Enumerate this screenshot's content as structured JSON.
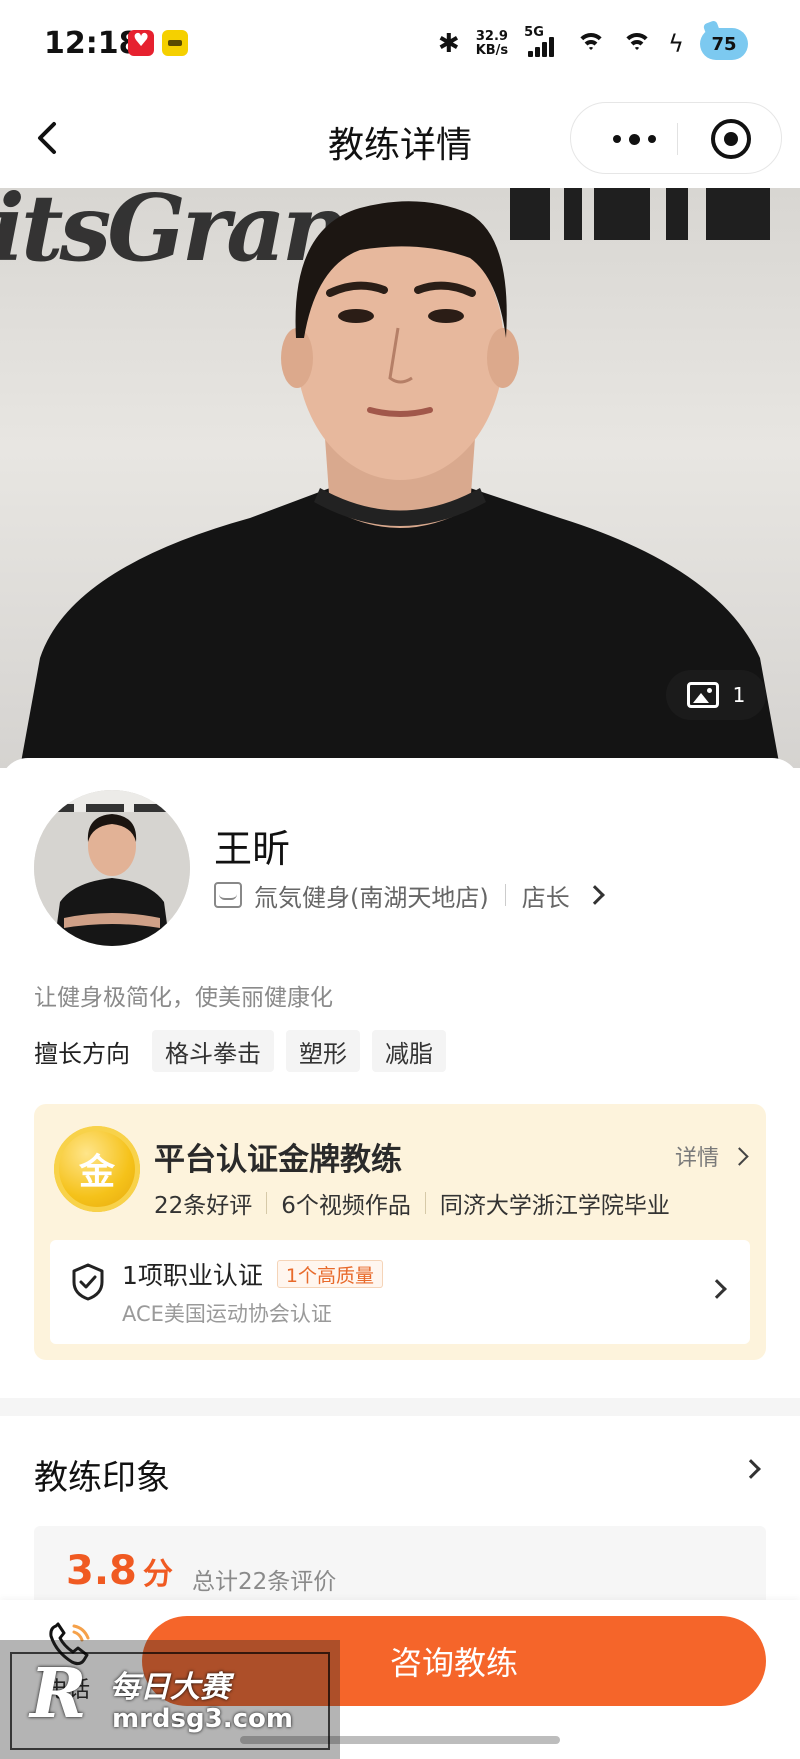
{
  "status_bar": {
    "time": "12:18",
    "net_speed_value": "32.9",
    "net_speed_unit": "KB/s",
    "signal_label": "5G",
    "battery": "75",
    "icons": [
      "heart-app-icon",
      "yellow-app-icon",
      "bluetooth-icon",
      "signal-icon",
      "wifi-icon",
      "wifi-icon",
      "charging-icon",
      "battery-icon"
    ]
  },
  "nav": {
    "title": "教练详情",
    "back_icon": "chevron-left-icon",
    "more_icon": "more-dots-icon",
    "close_icon": "target-close-icon"
  },
  "hero": {
    "banner_text": "itsGran",
    "image_count": "1"
  },
  "coach": {
    "name": "王昕",
    "store": "氚気健身(南湖天地店)",
    "role": "店长",
    "slogan": "让健身极简化，使美丽健康化",
    "skills_label": "擅长方向",
    "skills": [
      "格斗拳击",
      "塑形",
      "减脂"
    ]
  },
  "certification": {
    "medal_char": "金",
    "title": "平台认证金牌教练",
    "detail_label": "详情",
    "stats": [
      "22条好评",
      "6个视频作品",
      "同济大学浙江学院毕业"
    ],
    "professional": {
      "title": "1项职业认证",
      "badge": "1个高质量",
      "desc": "ACE美国运动协会认证"
    }
  },
  "impression": {
    "title": "教练印象",
    "score": "3.8",
    "score_unit": "分",
    "total": "总计22条评价"
  },
  "bottom": {
    "phone_label": "电话",
    "consult_button": "咨询教练"
  },
  "watermark": {
    "logo": "R",
    "cn": "每日大赛",
    "url": "mrdsg3.com"
  },
  "colors": {
    "accent": "#f5652a",
    "score": "#f05a22",
    "cert_bg": "#fdf3dc",
    "gold": "#f5c21a"
  }
}
